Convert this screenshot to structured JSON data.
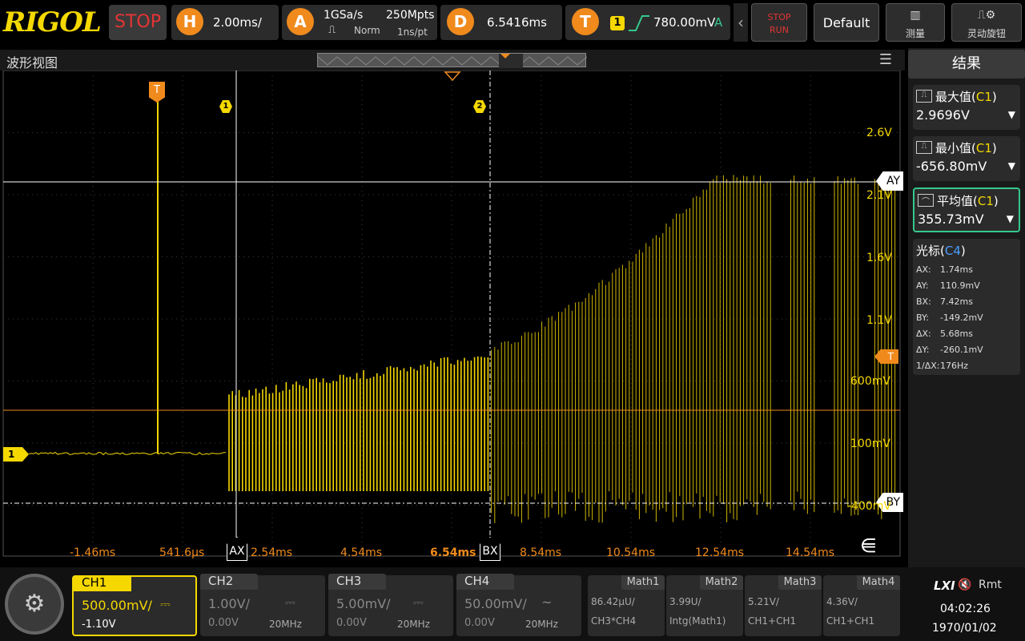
{
  "brand": "RIGOL",
  "run_state": "STOP",
  "horizontal": {
    "badge": "H",
    "scale": "2.00ms/"
  },
  "acquire": {
    "badge": "A",
    "sample_rate": "1GSa/s",
    "memory": "250Mpts",
    "mode": "Norm",
    "interval": "1ns/pt"
  },
  "delay": {
    "badge": "D",
    "value": "6.5416ms"
  },
  "trigger": {
    "badge": "T",
    "channel": "1",
    "level": "780.00mV",
    "mode_letter": "A"
  },
  "buttons": {
    "stop_run_top": "STOP",
    "stop_run_bottom": "RUN",
    "default": "Default",
    "measure": "测量",
    "flex_knob": "灵动旋钮"
  },
  "wave_title": "波形视图",
  "grid": {
    "x_labels": [
      "-1.46ms",
      "541.6μs",
      "2.54ms",
      "4.54ms",
      "6.54ms",
      "8.54ms",
      "10.54ms",
      "12.54ms",
      "14.54ms"
    ],
    "y_labels": [
      "2.6V",
      "2.1V",
      "1.6V",
      "1.1V",
      "600mV",
      "100mV",
      "-400mV"
    ],
    "cursor_ax": "AX",
    "cursor_bx": "BX",
    "cursor_ay": "AY",
    "cursor_by": "BY",
    "trigger_marker": "T",
    "ch1_marker": "1",
    "marker1": "1",
    "marker2": "2"
  },
  "results": {
    "title": "结果",
    "measurements": [
      {
        "name": "最大值",
        "channel": "C1",
        "value": "2.9696V"
      },
      {
        "name": "最小值",
        "channel": "C1",
        "value": "-656.80mV"
      },
      {
        "name": "平均值",
        "channel": "C1",
        "value": "355.73mV"
      }
    ],
    "cursor_title": "光标",
    "cursor_channel": "C4",
    "cursor_rows": [
      {
        "k": "AX:",
        "v": "1.74ms"
      },
      {
        "k": "AY:",
        "v": "110.9mV"
      },
      {
        "k": "BX:",
        "v": "7.42ms"
      },
      {
        "k": "BY:",
        "v": "-149.2mV"
      },
      {
        "k": "ΔX:",
        "v": "5.68ms"
      },
      {
        "k": "ΔY:",
        "v": "-260.1mV"
      },
      {
        "k": "1/ΔX:",
        "v": "176Hz"
      }
    ]
  },
  "channels": [
    {
      "name": "CH1",
      "scale": "500.00mV/",
      "offset": "-1.10V",
      "coupling": "",
      "bw": ""
    },
    {
      "name": "CH2",
      "scale": "1.00V/",
      "offset": "0.00V",
      "coupling": "",
      "bw": "20MHz"
    },
    {
      "name": "CH3",
      "scale": "5.00mV/",
      "offset": "0.00V",
      "coupling": "",
      "bw": "20MHz"
    },
    {
      "name": "CH4",
      "scale": "50.00mV/",
      "offset": "0.00V",
      "coupling": "~",
      "bw": "20MHz"
    }
  ],
  "math": [
    {
      "name": "Math1",
      "v1": "86.42μU/",
      "v2": "CH3*CH4"
    },
    {
      "name": "Math2",
      "v1": "3.99U/",
      "v2": "Intg(Math1)"
    },
    {
      "name": "Math3",
      "v1": "5.21V/",
      "v2": "CH1+CH1"
    },
    {
      "name": "Math4",
      "v1": "4.36V/",
      "v2": "CH1+CH1"
    }
  ],
  "status": {
    "lxi": "LXI",
    "remote": "Rmt",
    "time": "04:02:26",
    "date": "1970/01/02"
  }
}
